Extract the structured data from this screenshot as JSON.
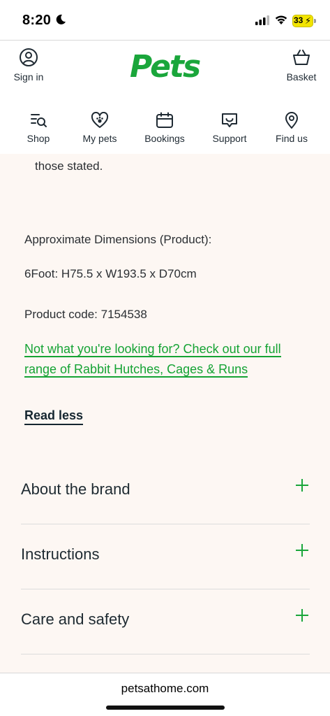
{
  "status_bar": {
    "time": "8:20",
    "battery": "33"
  },
  "header": {
    "sign_in": "Sign in",
    "logo": "Pets",
    "basket": "Basket"
  },
  "nav": [
    {
      "label": "Shop",
      "icon": "shop-search-icon"
    },
    {
      "label": "My pets",
      "icon": "heart-paw-icon"
    },
    {
      "label": "Bookings",
      "icon": "calendar-icon"
    },
    {
      "label": "Support",
      "icon": "chat-support-icon"
    },
    {
      "label": "Find us",
      "icon": "location-pin-icon"
    }
  ],
  "content": {
    "stated_text": "those stated.",
    "dimensions_heading": "Approximate Dimensions (Product):",
    "dimensions_value": "6Foot: H75.5 x W193.5 x D70cm",
    "product_code": "Product code: 7154538",
    "link_line1": "Not what you're looking for? Check out our full",
    "link_line2": "range of Rabbit Hutches, Cages & Runs",
    "read_less": "Read less"
  },
  "accordion": [
    {
      "title": "About the brand"
    },
    {
      "title": "Instructions"
    },
    {
      "title": "Care and safety"
    }
  ],
  "browser": {
    "url": "petsathome.com"
  },
  "colors": {
    "brand_green": "#1aa63b",
    "content_bg": "#fdf7f3",
    "text_dark": "#1f2a33"
  }
}
